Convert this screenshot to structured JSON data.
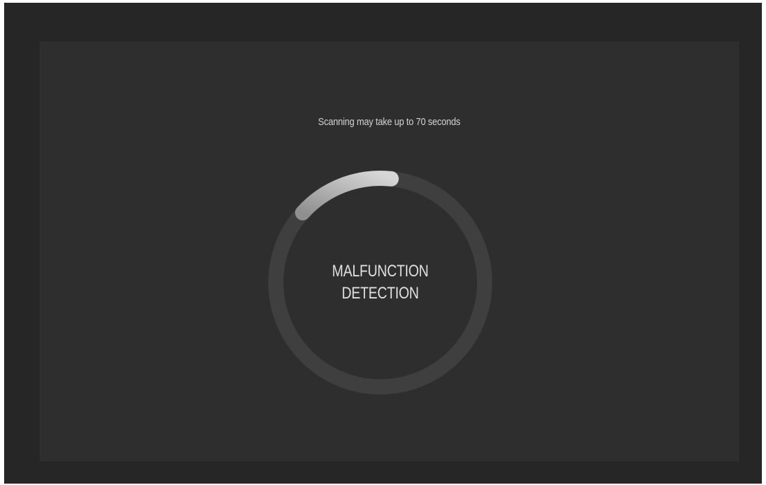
{
  "scan": {
    "hint": "Scanning may take up to 70 seconds",
    "title_line1": "MALFUNCTION",
    "title_line2": "DETECTION",
    "progress": 0.15
  },
  "colors": {
    "outer_background": "#262626",
    "panel_background": "#2e2e2e",
    "ring_track": "#3f3f3f",
    "ring_progress_start": "#8f8f8f",
    "ring_progress_end": "#d6d6d6",
    "text": "#e0e0e0"
  }
}
